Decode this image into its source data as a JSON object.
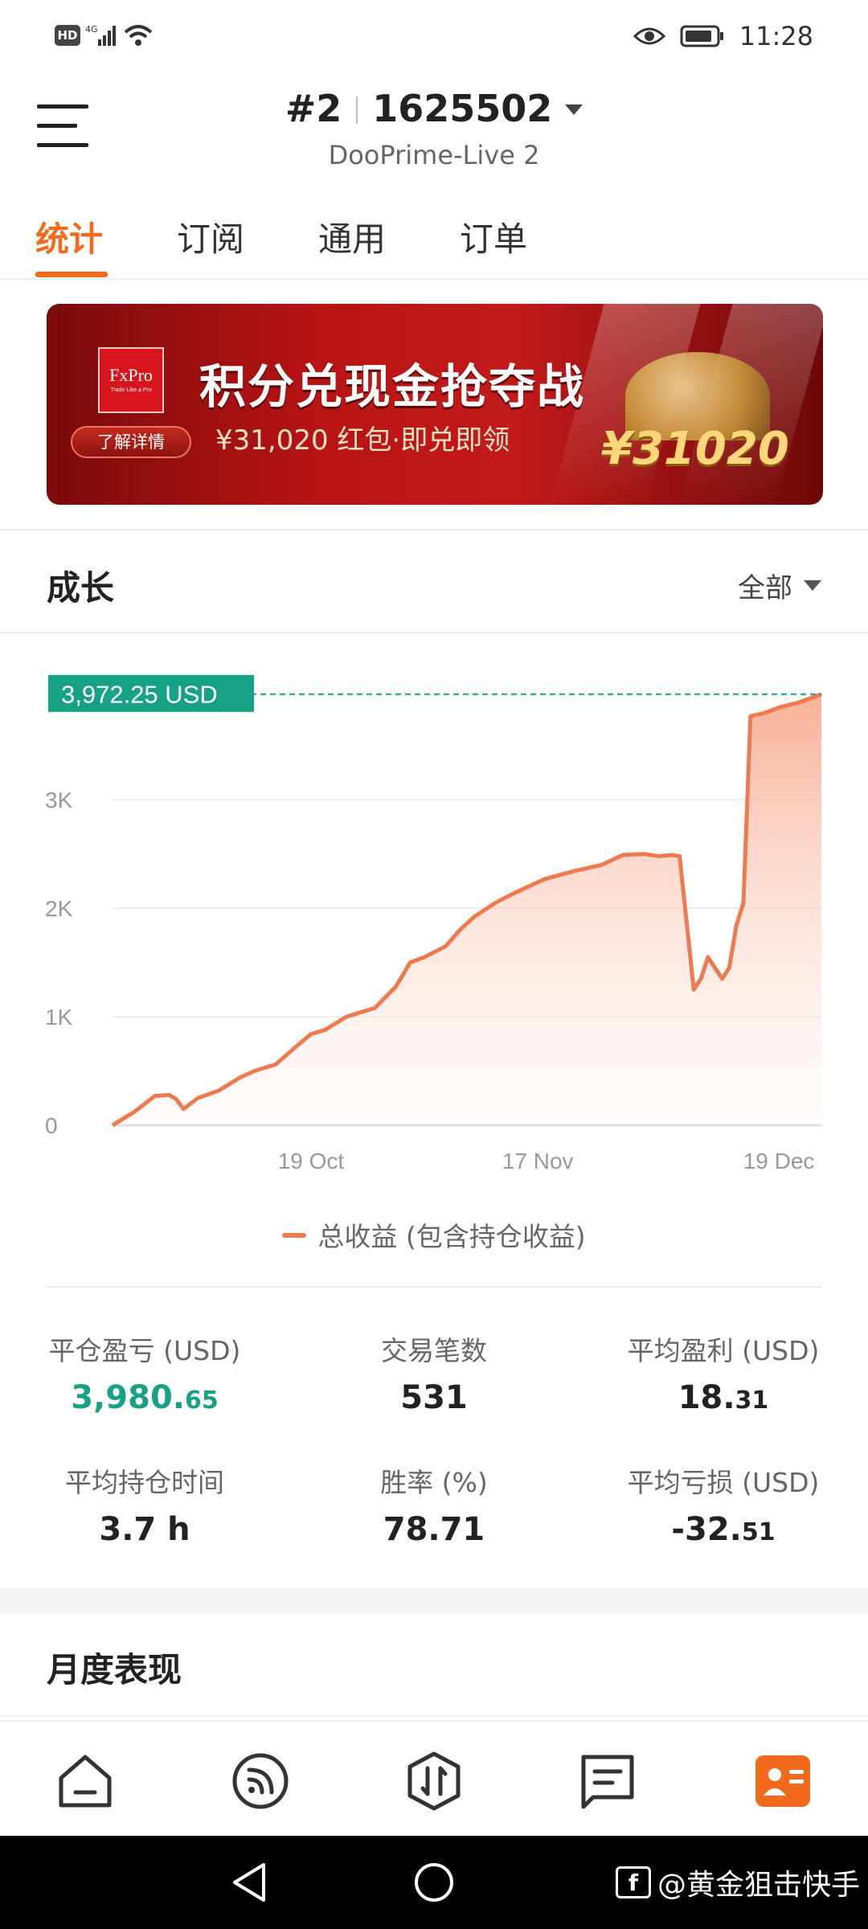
{
  "status_bar": {
    "hd": "HD",
    "network": "4G",
    "time": "11:28"
  },
  "header": {
    "account_index": "#2",
    "account_number": "1625502",
    "server": "DooPrime-Live 2"
  },
  "tabs": [
    {
      "label": "统计",
      "active": true
    },
    {
      "label": "订阅",
      "active": false
    },
    {
      "label": "通用",
      "active": false
    },
    {
      "label": "订单",
      "active": false
    }
  ],
  "banner": {
    "logo_text": "FxPro",
    "logo_tagline": "Trade Like a Pro",
    "button_label": "了解详情",
    "headline": "积分兑现金抢夺战",
    "subline": "¥31,020 红包·即兑即领",
    "amount": "¥31020"
  },
  "growth": {
    "title": "成长",
    "range": "全部",
    "current_value_label": "3,972.25 USD",
    "legend_label": "总收益 (包含持仓收益)"
  },
  "chart_data": {
    "type": "area",
    "ylim": [
      0,
      4000
    ],
    "y_ticks": [
      {
        "value": 0,
        "label": "0"
      },
      {
        "value": 1000,
        "label": "1K"
      },
      {
        "value": 2000,
        "label": "2K"
      },
      {
        "value": 3000,
        "label": "3K"
      }
    ],
    "x_ticks": [
      {
        "x": 0.28,
        "label": "19 Oct"
      },
      {
        "x": 0.6,
        "label": "17 Nov"
      },
      {
        "x": 0.94,
        "label": "19 Dec"
      }
    ],
    "x": [
      0,
      0.03,
      0.06,
      0.08,
      0.09,
      0.1,
      0.12,
      0.15,
      0.18,
      0.2,
      0.23,
      0.26,
      0.28,
      0.3,
      0.33,
      0.37,
      0.4,
      0.42,
      0.44,
      0.47,
      0.49,
      0.51,
      0.54,
      0.57,
      0.61,
      0.65,
      0.69,
      0.72,
      0.75,
      0.77,
      0.79,
      0.8,
      0.82,
      0.83,
      0.84,
      0.86,
      0.87,
      0.88,
      0.89,
      0.9,
      0.92,
      0.94,
      0.97,
      1.0
    ],
    "values": [
      0,
      120,
      270,
      280,
      240,
      150,
      250,
      320,
      440,
      500,
      560,
      730,
      840,
      880,
      1000,
      1080,
      1280,
      1500,
      1550,
      1650,
      1800,
      1920,
      2050,
      2150,
      2270,
      2340,
      2400,
      2490,
      2500,
      2480,
      2490,
      2480,
      1250,
      1350,
      1550,
      1350,
      1450,
      1840,
      2050,
      3770,
      3800,
      3850,
      3900,
      3972.25
    ],
    "series": [
      {
        "name": "总收益 (包含持仓收益)",
        "color": "#ef7a4f"
      }
    ],
    "marker_value": 3972.25,
    "marker_label": "3,972.25 USD"
  },
  "stats": {
    "closed_pnl": {
      "label": "平仓盈亏 (USD)",
      "int": "3,980.",
      "dec": "65"
    },
    "trades": {
      "label": "交易笔数",
      "value": "531"
    },
    "avg_profit": {
      "label": "平均盈利 (USD)",
      "int": "18.",
      "dec": "31"
    },
    "avg_hold": {
      "label": "平均持仓时间",
      "value": "3.7 h"
    },
    "win_rate": {
      "label": "胜率 (%)",
      "value": "78.71"
    },
    "avg_loss": {
      "label": "平均亏损 (USD)",
      "int": "-32.",
      "dec": "51"
    }
  },
  "monthly": {
    "title": "月度表现"
  },
  "bottom_nav": [
    {
      "icon": "home-icon"
    },
    {
      "icon": "signal-feed-icon"
    },
    {
      "icon": "trade-icon"
    },
    {
      "icon": "messages-icon"
    },
    {
      "icon": "profile-card-icon",
      "active": true
    }
  ],
  "watermark": {
    "text": "@黄金狙击快手"
  },
  "colors": {
    "accent": "#f26b1d",
    "green": "#17a187",
    "line": "#ef7a4f"
  }
}
